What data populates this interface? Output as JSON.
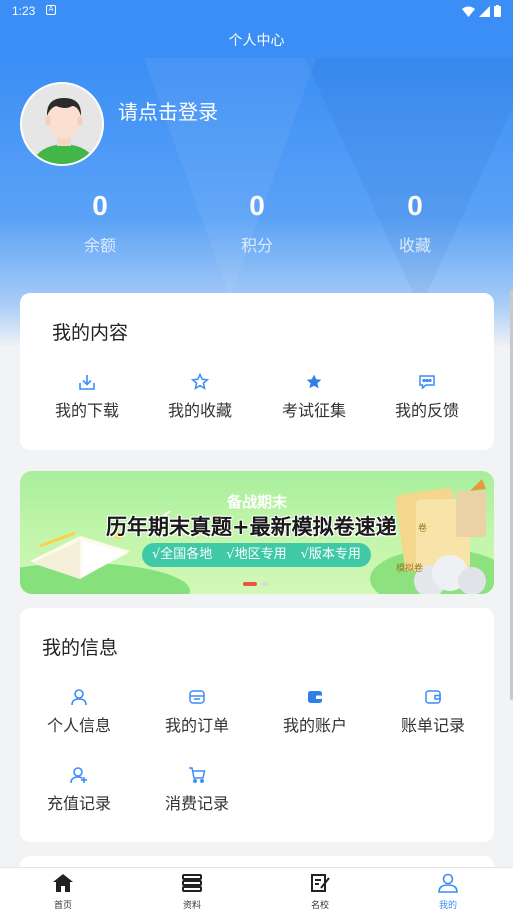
{
  "status": {
    "time": "1:23"
  },
  "header": {
    "title": "个人中心"
  },
  "profile": {
    "login_prompt": "请点击登录"
  },
  "stats": [
    {
      "value": "0",
      "label": "余额"
    },
    {
      "value": "0",
      "label": "积分"
    },
    {
      "value": "0",
      "label": "收藏"
    }
  ],
  "content_card": {
    "title": "我的内容",
    "items": [
      {
        "label": "我的下载",
        "icon": "download-icon"
      },
      {
        "label": "我的收藏",
        "icon": "star-outline-icon"
      },
      {
        "label": "考试征集",
        "icon": "star-filled-icon"
      },
      {
        "label": "我的反馈",
        "icon": "chat-icon"
      }
    ]
  },
  "banner": {
    "subtitle": "备战期末",
    "headline": "历年期末真题+最新模拟卷速递",
    "tags": [
      "√全国各地",
      "√地区专用",
      "√版本专用"
    ],
    "book_labels": [
      "卷",
      "模拟卷"
    ]
  },
  "info_card": {
    "title": "我的信息",
    "items": [
      {
        "label": "个人信息",
        "icon": "user-icon"
      },
      {
        "label": "我的订单",
        "icon": "order-icon"
      },
      {
        "label": "我的账户",
        "icon": "wallet-icon"
      },
      {
        "label": "账单记录",
        "icon": "bill-icon"
      },
      {
        "label": "充值记录",
        "icon": "user-add-icon"
      },
      {
        "label": "消费记录",
        "icon": "cart-icon"
      }
    ]
  },
  "bottom_nav": [
    {
      "label": "首页",
      "icon": "home-icon"
    },
    {
      "label": "资料",
      "icon": "materials-icon"
    },
    {
      "label": "名校",
      "icon": "school-icon"
    },
    {
      "label": "我的",
      "icon": "profile-icon",
      "active": true
    }
  ],
  "colors": {
    "accent": "#3b8ef5",
    "banner_green": "#a8ee9c",
    "pill": "#3fc9a6"
  }
}
